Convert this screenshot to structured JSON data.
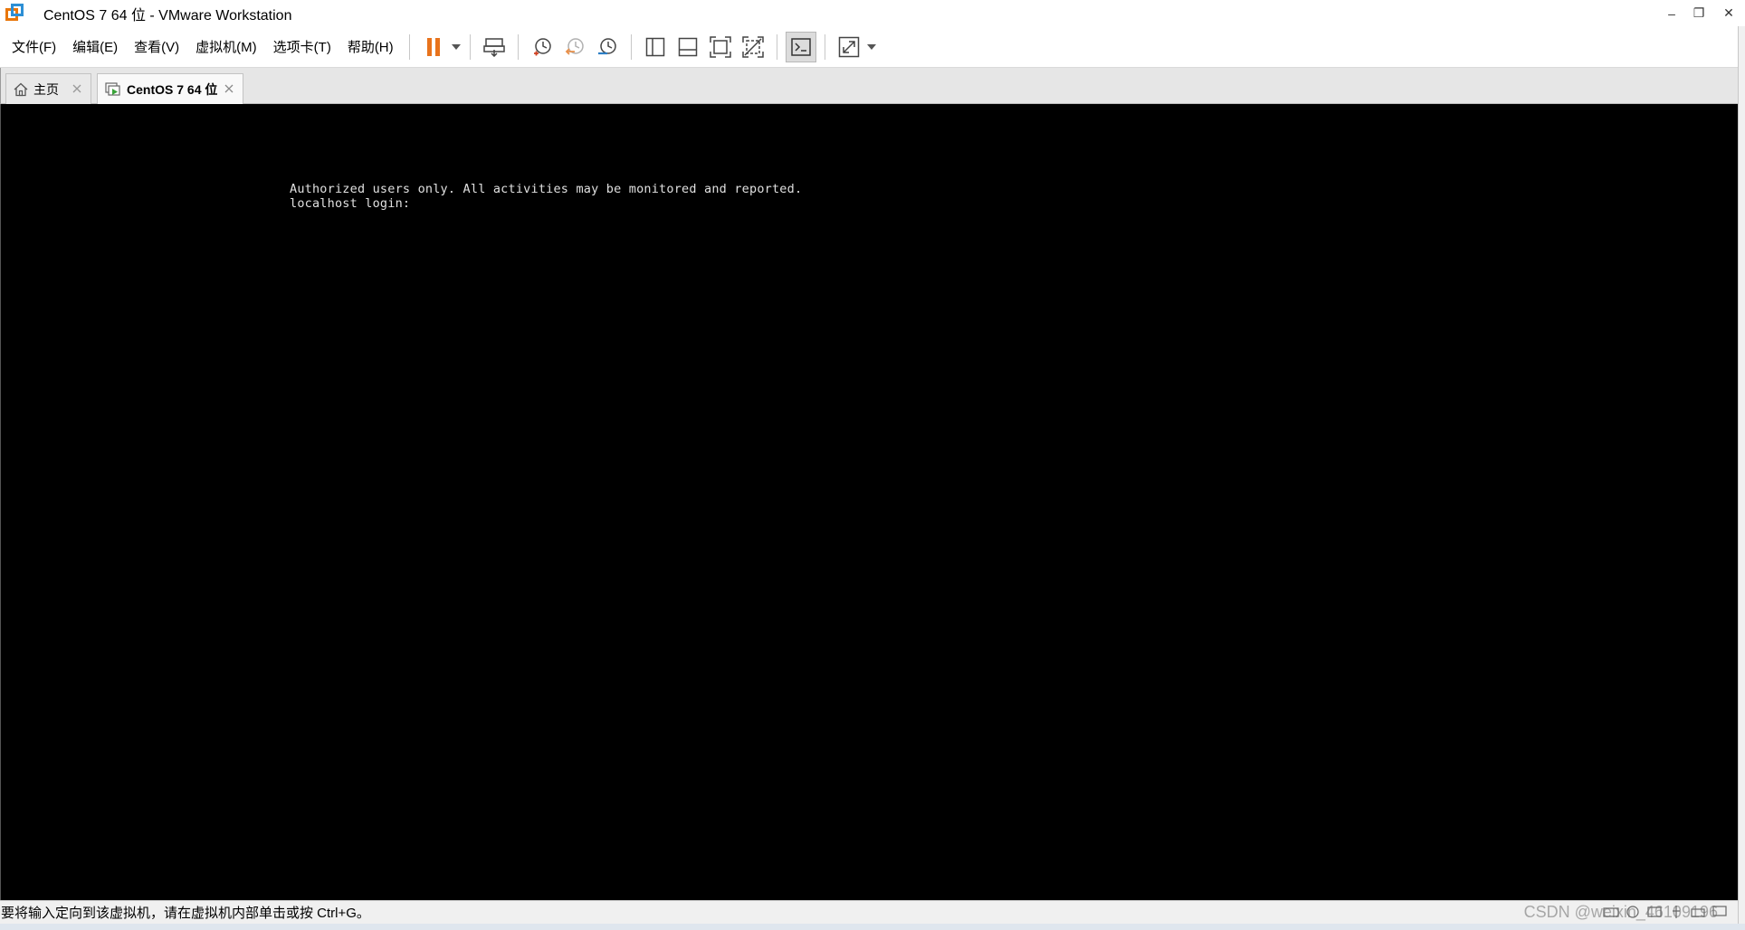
{
  "window": {
    "title": "CentOS 7 64 位 - VMware Workstation",
    "minimize": "–",
    "restore": "❐",
    "close": "✕"
  },
  "menu": {
    "items": [
      {
        "label": "文件(F)"
      },
      {
        "label": "编辑(E)"
      },
      {
        "label": "查看(V)"
      },
      {
        "label": "虚拟机(M)"
      },
      {
        "label": "选项卡(T)"
      },
      {
        "label": "帮助(H)"
      }
    ]
  },
  "toolbar": {
    "icons": [
      "pause-icon",
      "send-ctrl-alt-del-icon",
      "snapshot-take-icon",
      "snapshot-revert-icon",
      "snapshot-manager-icon",
      "show-library-icon",
      "show-thumbnail-icon",
      "full-screen-icon",
      "unity-icon",
      "console-view-icon",
      "stretch-icon"
    ],
    "pause_color": "#e8731c",
    "active_icon": "console-view-icon"
  },
  "tabs": [
    {
      "label": "主页",
      "icon": "home-icon",
      "active": false
    },
    {
      "label": "CentOS 7 64 位",
      "icon": "vm-running-icon",
      "active": true
    }
  ],
  "console": {
    "lines": [
      "Authorized users only. All activities may be monitored and reported.",
      "localhost login:"
    ]
  },
  "statusbar": {
    "hint": "要将输入定向到该虚拟机，请在虚拟机内部单击或按 Ctrl+G。",
    "watermark": "CSDN @weixin_46109196"
  }
}
